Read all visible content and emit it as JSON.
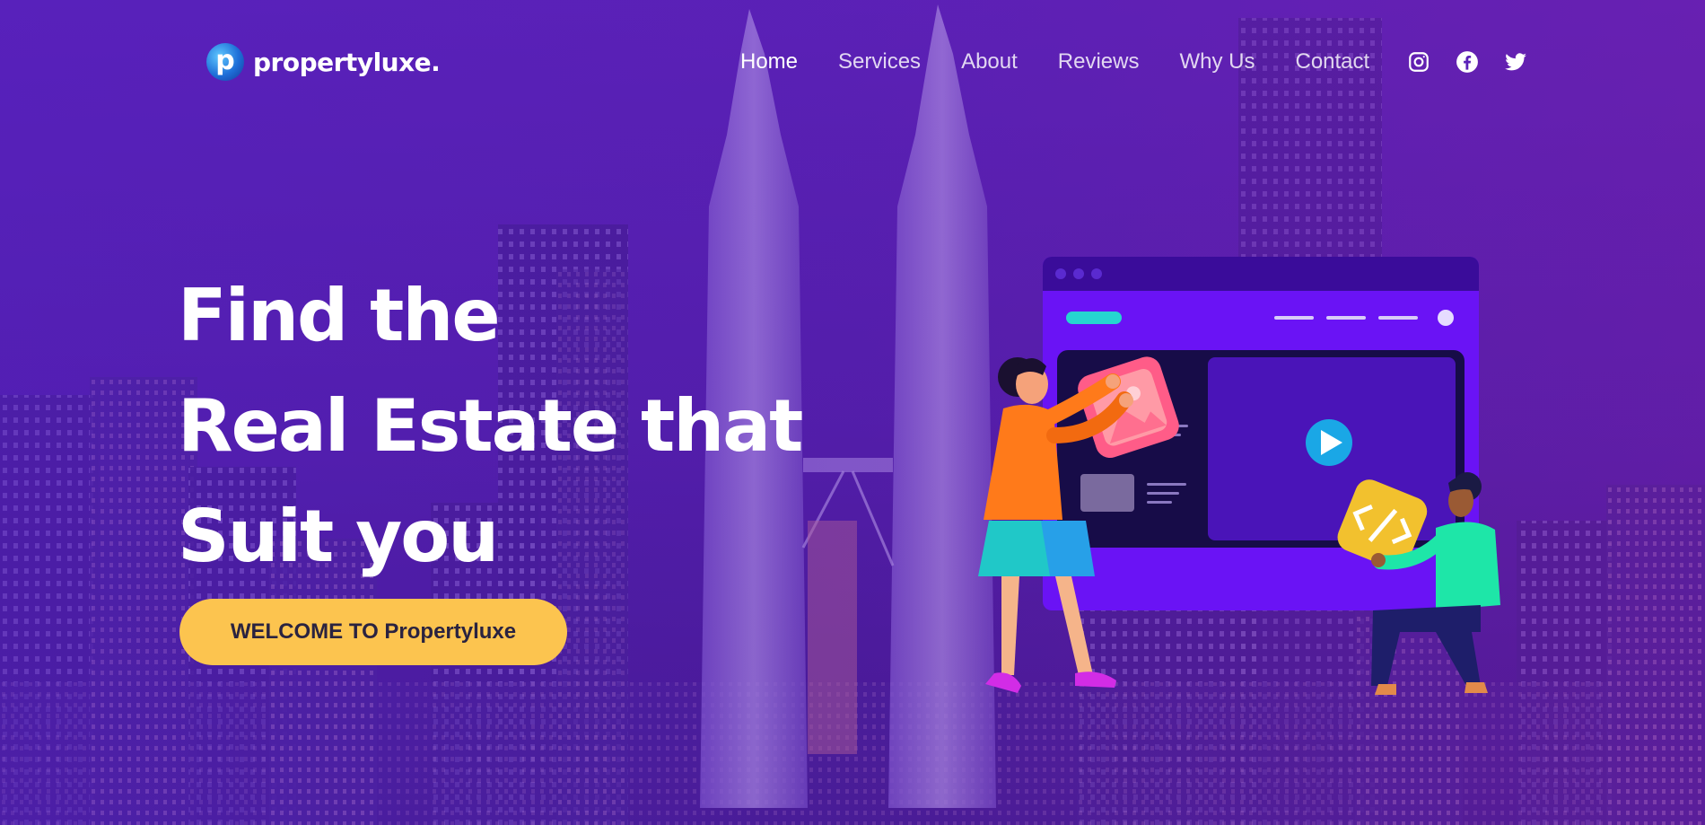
{
  "brand": {
    "logo_letter": "p",
    "name": "propertyluxe."
  },
  "nav": {
    "items": [
      {
        "label": "Home",
        "active": true
      },
      {
        "label": "Services",
        "active": false
      },
      {
        "label": "About",
        "active": false
      },
      {
        "label": "Reviews",
        "active": false
      },
      {
        "label": "Why Us",
        "active": false
      },
      {
        "label": "Contact",
        "active": false
      }
    ]
  },
  "socials": [
    "instagram-icon",
    "facebook-icon",
    "twitter-icon"
  ],
  "hero": {
    "title_lines": [
      "Find the",
      "Real Estate that",
      "Suit you"
    ],
    "cta_label": "WELCOME TO Propertyluxe"
  },
  "colors": {
    "accent": "#fcc44f",
    "overlay_purple": "#5620be",
    "browser_purple": "#6a13f5"
  }
}
